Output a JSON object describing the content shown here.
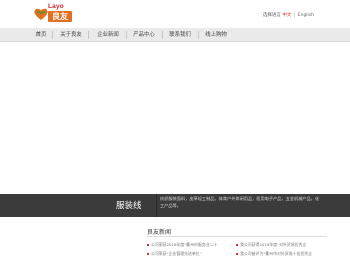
{
  "brand": {
    "name_en": "Layo",
    "name_cn": "良友",
    "brand_color": "#e26f22",
    "accent_color": "#d2232a"
  },
  "language": {
    "label": "选择语言",
    "chinese": "中文",
    "separator": "|",
    "english": "English"
  },
  "nav": {
    "items": [
      {
        "label": "首页"
      },
      {
        "label": "关于良友"
      },
      {
        "label": "企业新闻"
      },
      {
        "label": "产品中心"
      },
      {
        "label": "联系我们"
      },
      {
        "label": "线上购物"
      }
    ]
  },
  "product_band": {
    "title": "服装线",
    "description": "纺织服装面料，皮革轻工制品，体育户外休闲用品，医用电子产品，五金机械产品，化工产品等。",
    "background": "#3b3b3b"
  },
  "news": {
    "title": "良友新闻",
    "items": [
      {
        "text": "公司荣获2018年度“衢州市服务业二十"
      },
      {
        "text": "公司荣获“企业管理先进单位”"
      },
      {
        "text": "我公司获得2018年度“对外贸易优秀企"
      },
      {
        "text": "我公司被评为“衢州市对外贸易十佳优秀企"
      }
    ]
  }
}
